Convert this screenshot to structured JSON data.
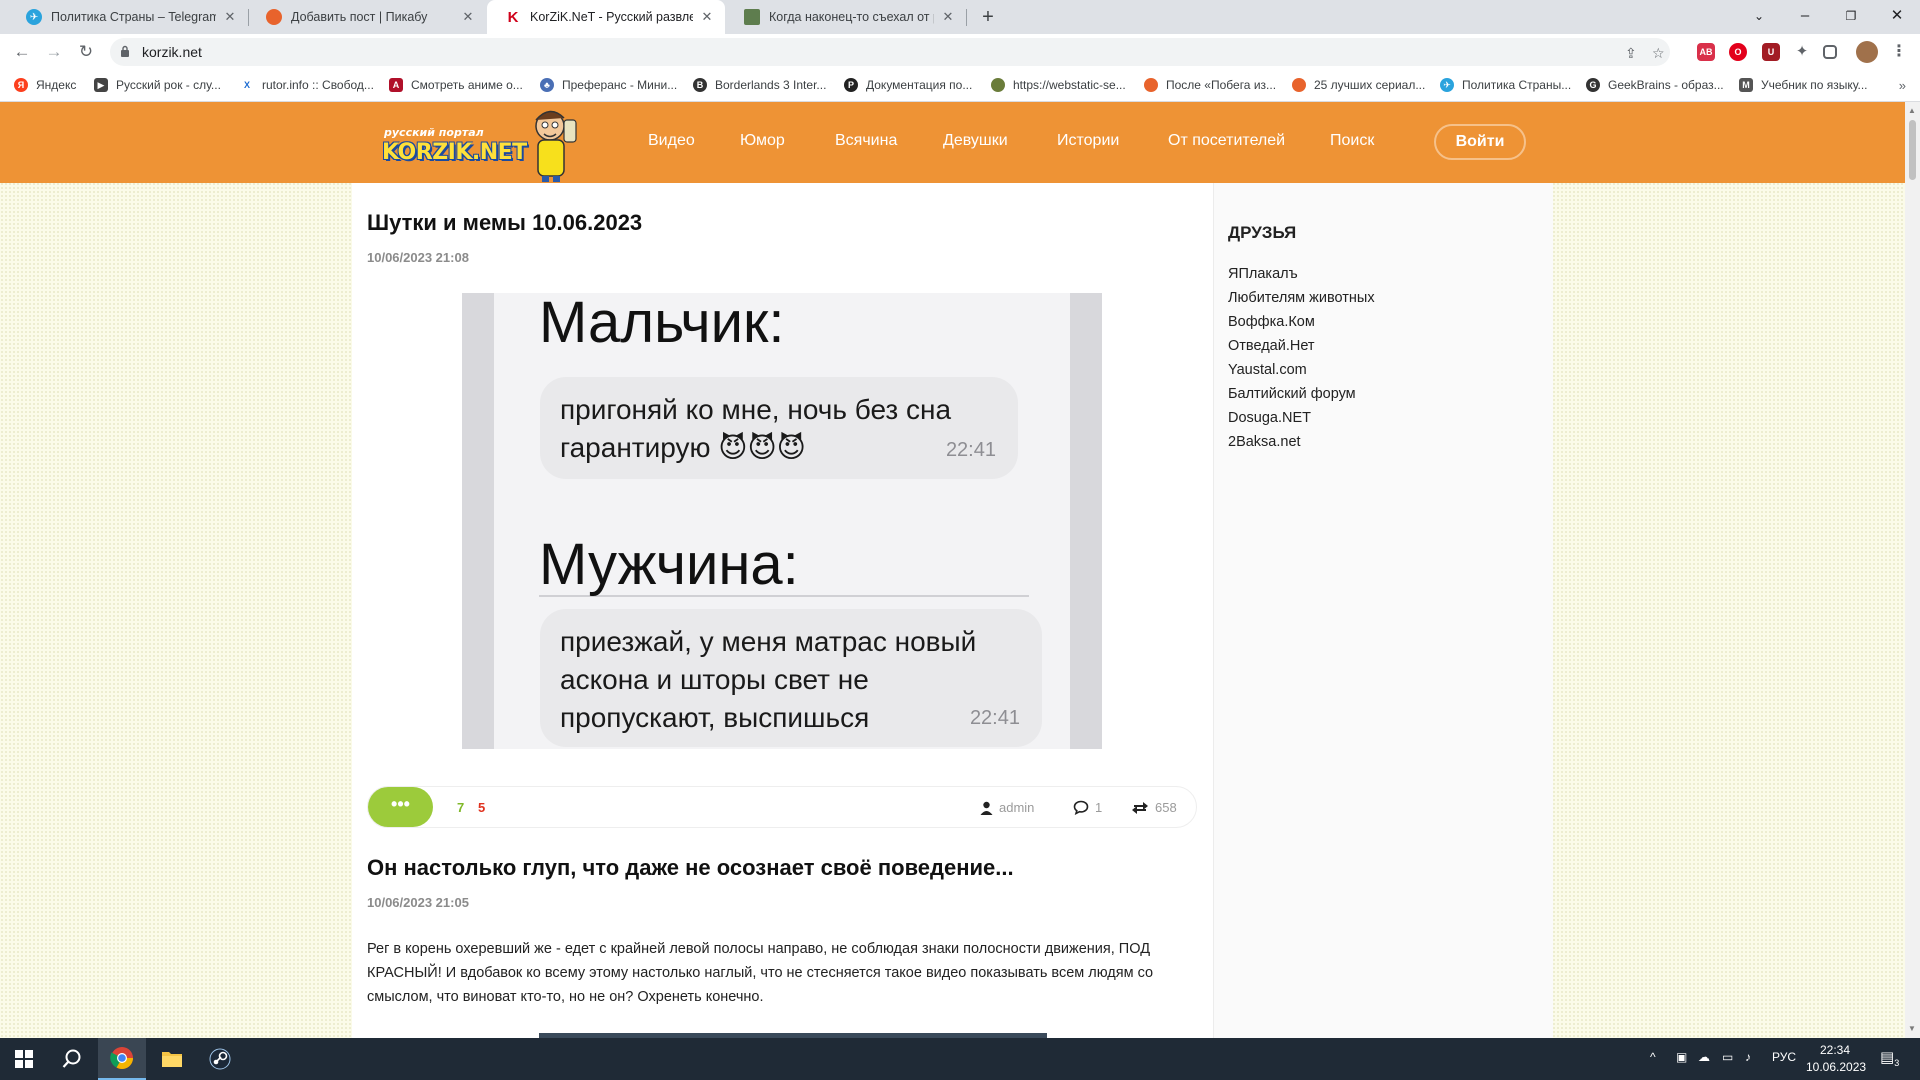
{
  "browser": {
    "tabs": [
      {
        "title": "Политика Страны – Telegram",
        "color": "#2aa3dd",
        "glyph": "✈"
      },
      {
        "title": "Добавить пост | Пикабу",
        "color": "#e8632c",
        "glyph": "●"
      },
      {
        "title": "KorZiK.NeT - Русский развлекат",
        "color": "#d0021b",
        "glyph": "K"
      },
      {
        "title": "Когда наконец-то съехал от ро",
        "color": "#5e7d4e",
        "glyph": "▪"
      }
    ],
    "active_tab": 2,
    "url": "korzik.net",
    "bookmarks": [
      {
        "label": "Яндекс",
        "color": "#fc3f1d",
        "glyph": "Я"
      },
      {
        "label": "Русский рок - слу...",
        "color": "#444",
        "glyph": "▶"
      },
      {
        "label": "rutor.info :: Свобод...",
        "color": "#1b6bd1",
        "glyph": "X"
      },
      {
        "label": "Смотреть аниме о...",
        "color": "#b0102a",
        "glyph": "A"
      },
      {
        "label": "Преферанс - Мини...",
        "color": "#4a6fb5",
        "glyph": "♣"
      },
      {
        "label": "Borderlands 3 Inter...",
        "color": "#333",
        "glyph": "B"
      },
      {
        "label": "Документация по...",
        "color": "#222",
        "glyph": "P"
      },
      {
        "label": "https://webstatic-se...",
        "color": "#6a7c3a",
        "glyph": "●"
      },
      {
        "label": "После «Побега из...",
        "color": "#e8632c",
        "glyph": "●"
      },
      {
        "label": "25 лучших сериал...",
        "color": "#e8632c",
        "glyph": "●"
      },
      {
        "label": "Политика Страны...",
        "color": "#2aa3dd",
        "glyph": "✈"
      },
      {
        "label": "GeekBrains - образ...",
        "color": "#333",
        "glyph": "G"
      },
      {
        "label": "Учебник по языку...",
        "color": "#555",
        "glyph": "M"
      }
    ],
    "bookmarks_more": "»"
  },
  "site": {
    "logo_small": "русский портал",
    "logo_big": "KORZIK.NET",
    "menu": [
      "Видео",
      "Юмор",
      "Всячина",
      "Девушки",
      "Истории",
      "От посетителей",
      "Поиск"
    ],
    "login": "Войти"
  },
  "posts": [
    {
      "title": "Шутки и мемы 10.06.2023",
      "date": "10/06/2023 21:08",
      "meme": {
        "label1": "Мальчик:",
        "bubble1_lines": [
          "пригоняй ко мне, ночь без сна",
          "гарантирую 😈😈😈"
        ],
        "bubble1_time": "22:41",
        "label2": "Мужчина:",
        "bubble2_lines": [
          "приезжай, у меня матрас новый",
          "аскона и шторы свет не",
          "пропускают, выспишься"
        ],
        "bubble2_time": "22:41"
      },
      "more": "•••",
      "votes_up": "7",
      "votes_down": "5",
      "author": "admin",
      "comments": "1",
      "views": "658"
    },
    {
      "title": "Он настолько глуп, что даже не осознает своё поведение...",
      "date": "10/06/2023 21:05",
      "text": "Рег в корень охеревший же - едет с крайней левой полосы направо, не соблюдая знаки полосности движения, ПОД КРАСНЫЙ! И вдобавок ко всему этому настолько наглый, что не стесняется такое видео показывать всем людям со смыслом, что виноват кто-то, но не он? Охренеть конечно."
    }
  ],
  "sidebar": {
    "title": "ДРУЗЬЯ",
    "links": [
      "ЯПлакалъ",
      "Любителям животных",
      "Воффка.Ком",
      "Отведай.Нет",
      "Yaustal.com",
      "Балтийский форум",
      "Dosuga.NET",
      "2Baksa.net"
    ]
  },
  "taskbar": {
    "lang": "РУС",
    "time": "22:34",
    "date": "10.06.2023",
    "notifications": "3"
  },
  "colors": {
    "header": "#ee9335",
    "accent_green": "#9ccb3b",
    "vote_up": "#7fb828",
    "vote_down": "#e0321f"
  }
}
